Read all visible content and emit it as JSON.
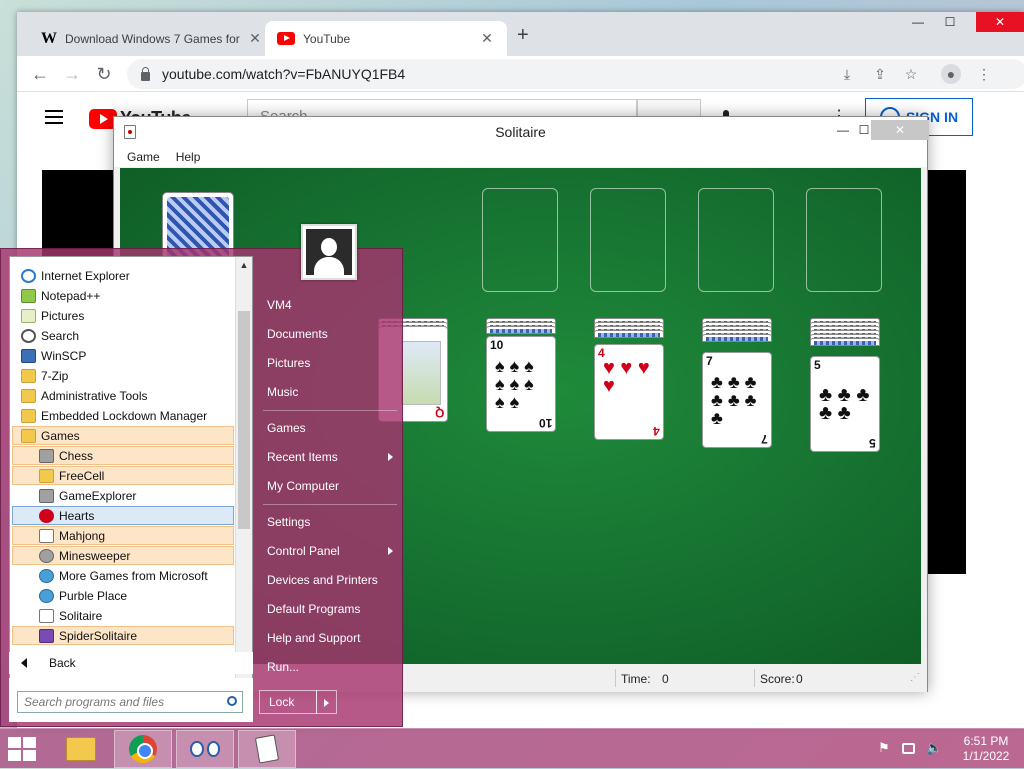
{
  "browser": {
    "tabs": [
      {
        "title": "Download Windows 7 Games for",
        "favicon": "w-icon",
        "active": false
      },
      {
        "title": "YouTube",
        "favicon": "youtube-icon",
        "active": true
      }
    ],
    "url": "youtube.com/watch?v=FbANUYQ1FB4",
    "window_controls": {
      "minimize": "—",
      "maximize": "☐",
      "close": "✕"
    }
  },
  "youtube": {
    "logo_text": "YouTube",
    "search_placeholder": "Search",
    "sign_in": "SIGN IN"
  },
  "solitaire": {
    "title": "Solitaire",
    "menu": [
      "Game",
      "Help"
    ],
    "status": {
      "time_label": "Time:",
      "time_value": "0",
      "score_label": "Score:",
      "score_value": "0"
    },
    "cards": {
      "queen": {
        "rank": "Q",
        "suit": "♦",
        "color": "#d0021b"
      },
      "ten": {
        "rank": "10",
        "suit": "♠",
        "color": "#111111"
      },
      "four": {
        "rank": "4",
        "suit": "♥",
        "color": "#d0021b"
      },
      "seven": {
        "rank": "7",
        "suit": "♣",
        "color": "#111111"
      },
      "five": {
        "rank": "5",
        "suit": "♣",
        "color": "#111111"
      }
    }
  },
  "start_menu": {
    "programs": [
      {
        "label": "Internet Explorer",
        "icon": "ie-icon"
      },
      {
        "label": "Notepad++",
        "icon": "notepad-icon"
      },
      {
        "label": "Pictures",
        "icon": "pictures-icon"
      },
      {
        "label": "Search",
        "icon": "search-icon"
      },
      {
        "label": "WinSCP",
        "icon": "winscp-icon"
      },
      {
        "label": "7-Zip",
        "icon": "folder-icon"
      },
      {
        "label": "Administrative Tools",
        "icon": "folder-icon"
      },
      {
        "label": "Embedded Lockdown Manager",
        "icon": "folder-icon"
      },
      {
        "label": "Games",
        "icon": "folder-icon"
      },
      {
        "label": "Chess",
        "icon": "chess-icon"
      },
      {
        "label": "FreeCell",
        "icon": "freecell-icon"
      },
      {
        "label": "GameExplorer",
        "icon": "game-explorer-icon"
      },
      {
        "label": "Hearts",
        "icon": "hearts-icon"
      },
      {
        "label": "Mahjong",
        "icon": "mahjong-icon"
      },
      {
        "label": "Minesweeper",
        "icon": "minesweeper-icon"
      },
      {
        "label": "More Games from Microsoft",
        "icon": "more-games-icon"
      },
      {
        "label": "Purble Place",
        "icon": "purble-place-icon"
      },
      {
        "label": "Solitaire",
        "icon": "solitaire-icon"
      },
      {
        "label": "SpiderSolitaire",
        "icon": "spider-solitaire-icon"
      }
    ],
    "back": "Back",
    "search_placeholder": "Search programs and files",
    "right": {
      "user": "VM4",
      "documents": "Documents",
      "pictures": "Pictures",
      "music": "Music",
      "games": "Games",
      "recent": "Recent Items",
      "computer": "My Computer",
      "settings": "Settings",
      "control_panel": "Control Panel",
      "devices": "Devices and Printers",
      "defaults": "Default Programs",
      "help": "Help and Support",
      "run": "Run..."
    },
    "lock": "Lock"
  },
  "taskbar": {
    "items": [
      "file-explorer-icon",
      "chrome-icon",
      "eyes-icon",
      "solitaire-icon"
    ],
    "time": "6:51 PM",
    "date": "1/1/2022"
  }
}
